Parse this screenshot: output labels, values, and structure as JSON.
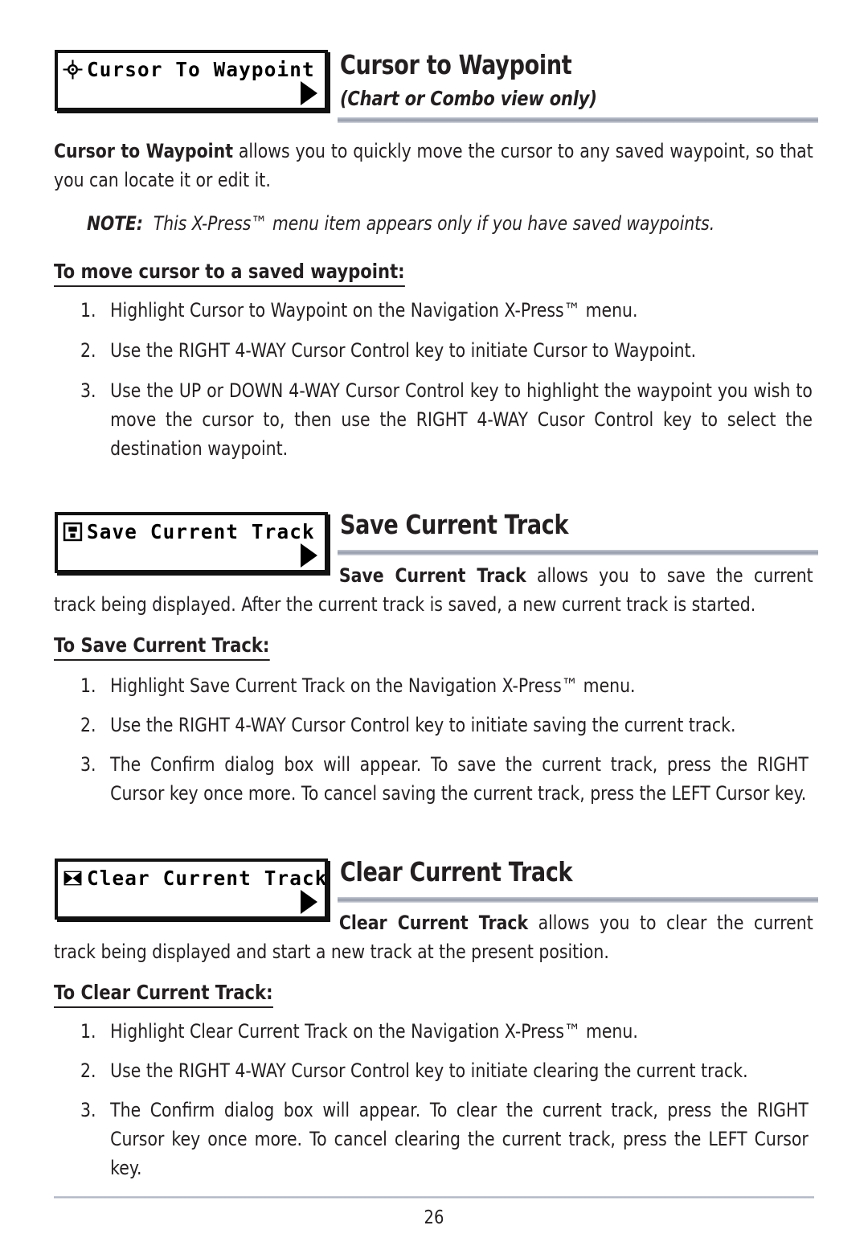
{
  "page": {
    "number": "26"
  },
  "sections": [
    {
      "id": "cursor-to-waypoint",
      "lcd": {
        "label": "Cursor To Waypoint",
        "icon": "crosshair-target-icon",
        "arrow": "right-triangle-icon"
      },
      "title": "Cursor to Waypoint",
      "subtitle": "(Chart or Combo view only)",
      "intro_bold": "Cursor to Waypoint",
      "intro_rest": " allows you to quickly move the cursor to any saved waypoint, so that you can locate it or edit it.",
      "note_label": "NOTE:",
      "note_text": "This X-Press™ menu item appears only if you have saved waypoints.",
      "subhead": "To move cursor to a saved waypoint:",
      "steps": [
        {
          "num": "1.",
          "text": "Highlight Cursor to Waypoint on the Navigation X-Press™ menu."
        },
        {
          "num": "2.",
          "text": "Use the RIGHT 4-WAY Cursor Control key to initiate Cursor to Waypoint."
        },
        {
          "num": "3.",
          "text": "Use the UP or DOWN 4-WAY Cursor Control key to highlight the waypoint you wish to move the cursor to, then use the RIGHT 4-WAY Cusor Control key to select the destination waypoint."
        }
      ]
    },
    {
      "id": "save-current-track",
      "lcd": {
        "label": "Save Current Track",
        "icon": "floppy-disk-save-icon",
        "arrow": "right-triangle-icon"
      },
      "title": "Save Current Track",
      "subtitle": "",
      "intro_bold": "Save Current Track",
      "intro_rest": " allows you to save the current track being displayed. After the current track is saved, a new current track is started.",
      "subhead": "To Save Current Track:",
      "steps": [
        {
          "num": "1.",
          "text": "Highlight Save Current Track on the Navigation X-Press™ menu."
        },
        {
          "num": "2.",
          "text": "Use the RIGHT 4-WAY Cursor Control key to initiate saving the current track."
        },
        {
          "num": "3.",
          "text": "The Confirm dialog box will appear. To save the current track,  press the RIGHT Cursor key once more. To cancel saving the current track, press the LEFT Cursor key."
        }
      ]
    },
    {
      "id": "clear-current-track",
      "lcd": {
        "label": "Clear Current Track",
        "icon": "x-box-clear-icon",
        "arrow": "right-triangle-icon"
      },
      "title": "Clear Current Track",
      "subtitle": "",
      "intro_bold": "Clear Current Track",
      "intro_rest": " allows you to clear the current track being displayed and start a new track at the present position.",
      "subhead": "To Clear Current Track:",
      "steps": [
        {
          "num": "1.",
          "text": "Highlight Clear Current Track on the Navigation X-Press™ menu."
        },
        {
          "num": "2.",
          "text": "Use the RIGHT 4-WAY Cursor Control key to initiate clearing the current track."
        },
        {
          "num": "3.",
          "text": "The Confirm dialog box will appear. To clear the current track,  press the RIGHT Cursor key once more. To cancel clearing the current track, press the LEFT Cursor key."
        }
      ]
    }
  ],
  "colors": {
    "text": "#231f20",
    "rule": "#9aa0ae",
    "lcd_border": "#111111"
  }
}
